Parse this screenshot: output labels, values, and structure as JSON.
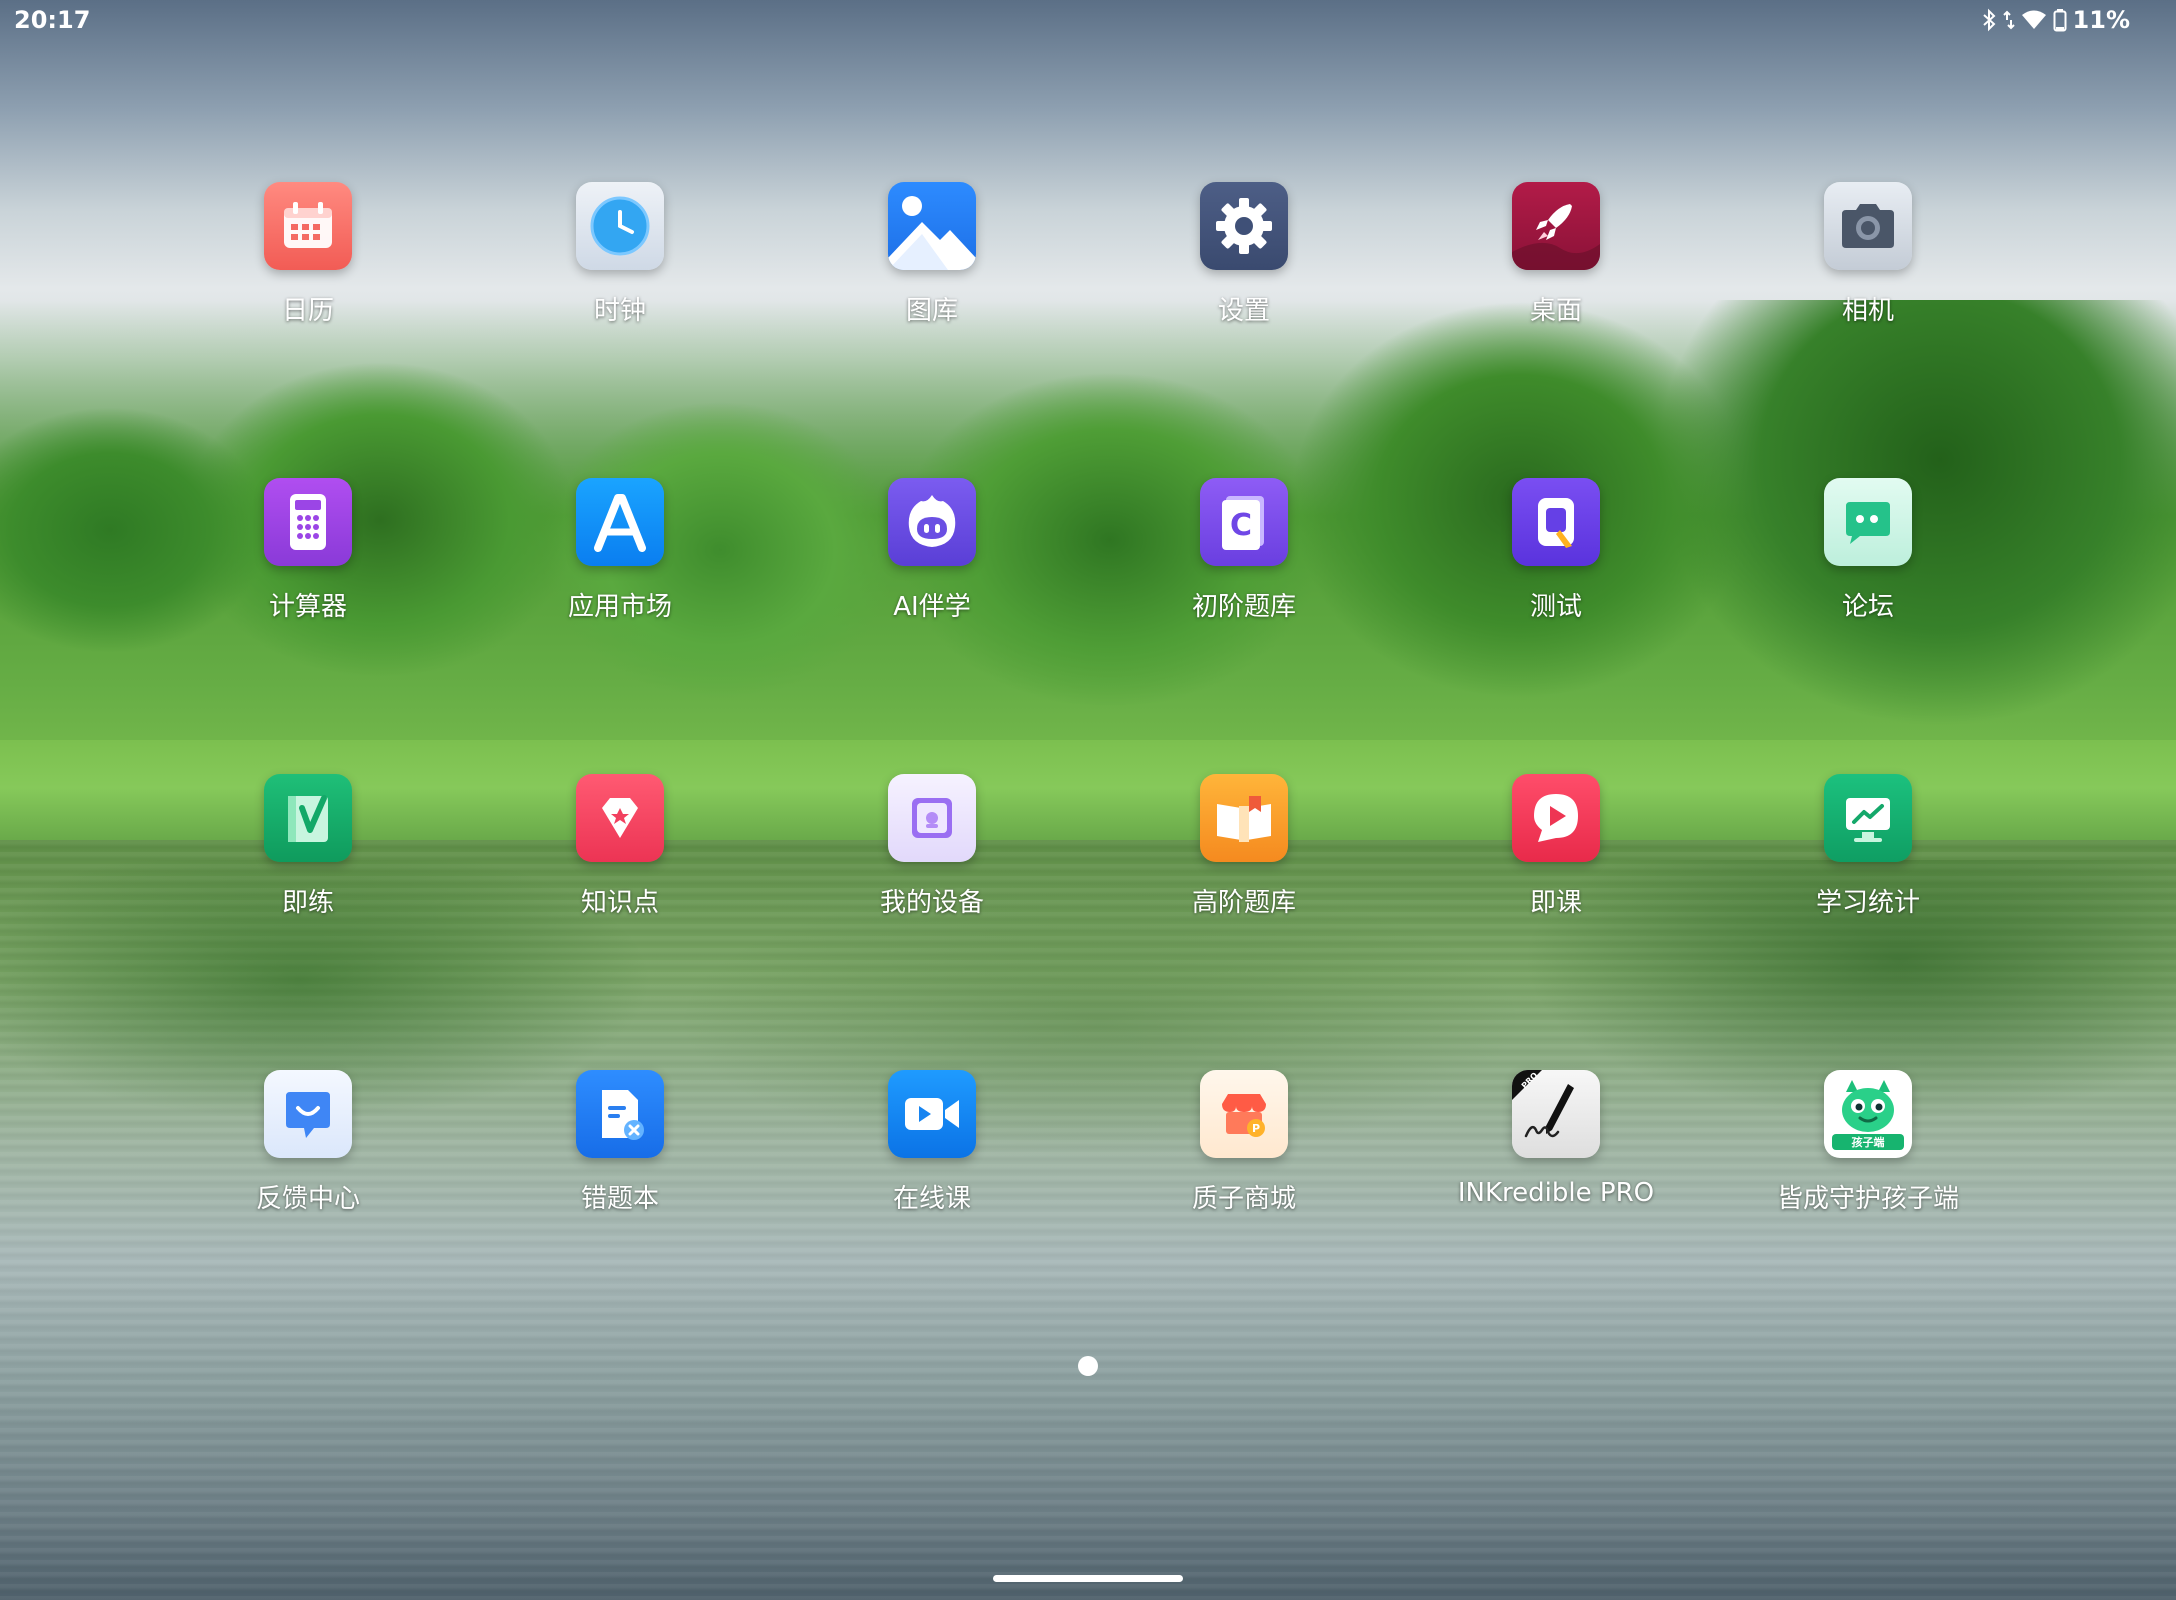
{
  "status_bar": {
    "time": "20:17",
    "battery": "11%",
    "icons": [
      "bluetooth-icon",
      "data-arrows-icon",
      "wifi-icon",
      "battery-icon"
    ]
  },
  "apps": [
    {
      "label": "日历",
      "icon": "calendar-icon"
    },
    {
      "label": "时钟",
      "icon": "clock-icon"
    },
    {
      "label": "图库",
      "icon": "gallery-icon"
    },
    {
      "label": "设置",
      "icon": "settings-gear-icon"
    },
    {
      "label": "桌面",
      "icon": "rocket-icon"
    },
    {
      "label": "相机",
      "icon": "camera-icon"
    },
    {
      "label": "计算器",
      "icon": "calculator-icon"
    },
    {
      "label": "应用市场",
      "icon": "app-store-icon"
    },
    {
      "label": "AI伴学",
      "icon": "ai-buddy-icon"
    },
    {
      "label": "初阶题库",
      "icon": "question-bank-c-icon"
    },
    {
      "label": "测试",
      "icon": "test-icon"
    },
    {
      "label": "论坛",
      "icon": "forum-chat-icon"
    },
    {
      "label": "即练",
      "icon": "practice-book-icon"
    },
    {
      "label": "知识点",
      "icon": "knowledge-gem-icon"
    },
    {
      "label": "我的设备",
      "icon": "my-device-icon"
    },
    {
      "label": "高阶题库",
      "icon": "advanced-question-bank-icon"
    },
    {
      "label": "即课",
      "icon": "lesson-play-icon"
    },
    {
      "label": "学习统计",
      "icon": "study-stats-icon"
    },
    {
      "label": "反馈中心",
      "icon": "feedback-smile-icon"
    },
    {
      "label": "错题本",
      "icon": "error-notebook-icon"
    },
    {
      "label": "在线课",
      "icon": "online-class-video-icon"
    },
    {
      "label": "质子商城",
      "icon": "store-icon"
    },
    {
      "label": "INKredible PRO",
      "icon": "inkredible-pen-icon",
      "badge": "PRO"
    },
    {
      "label": "皆成守护孩子端",
      "icon": "guardian-kid-icon",
      "badge": "孩子端"
    }
  ],
  "pager": {
    "pages": 1,
    "current": 1
  }
}
